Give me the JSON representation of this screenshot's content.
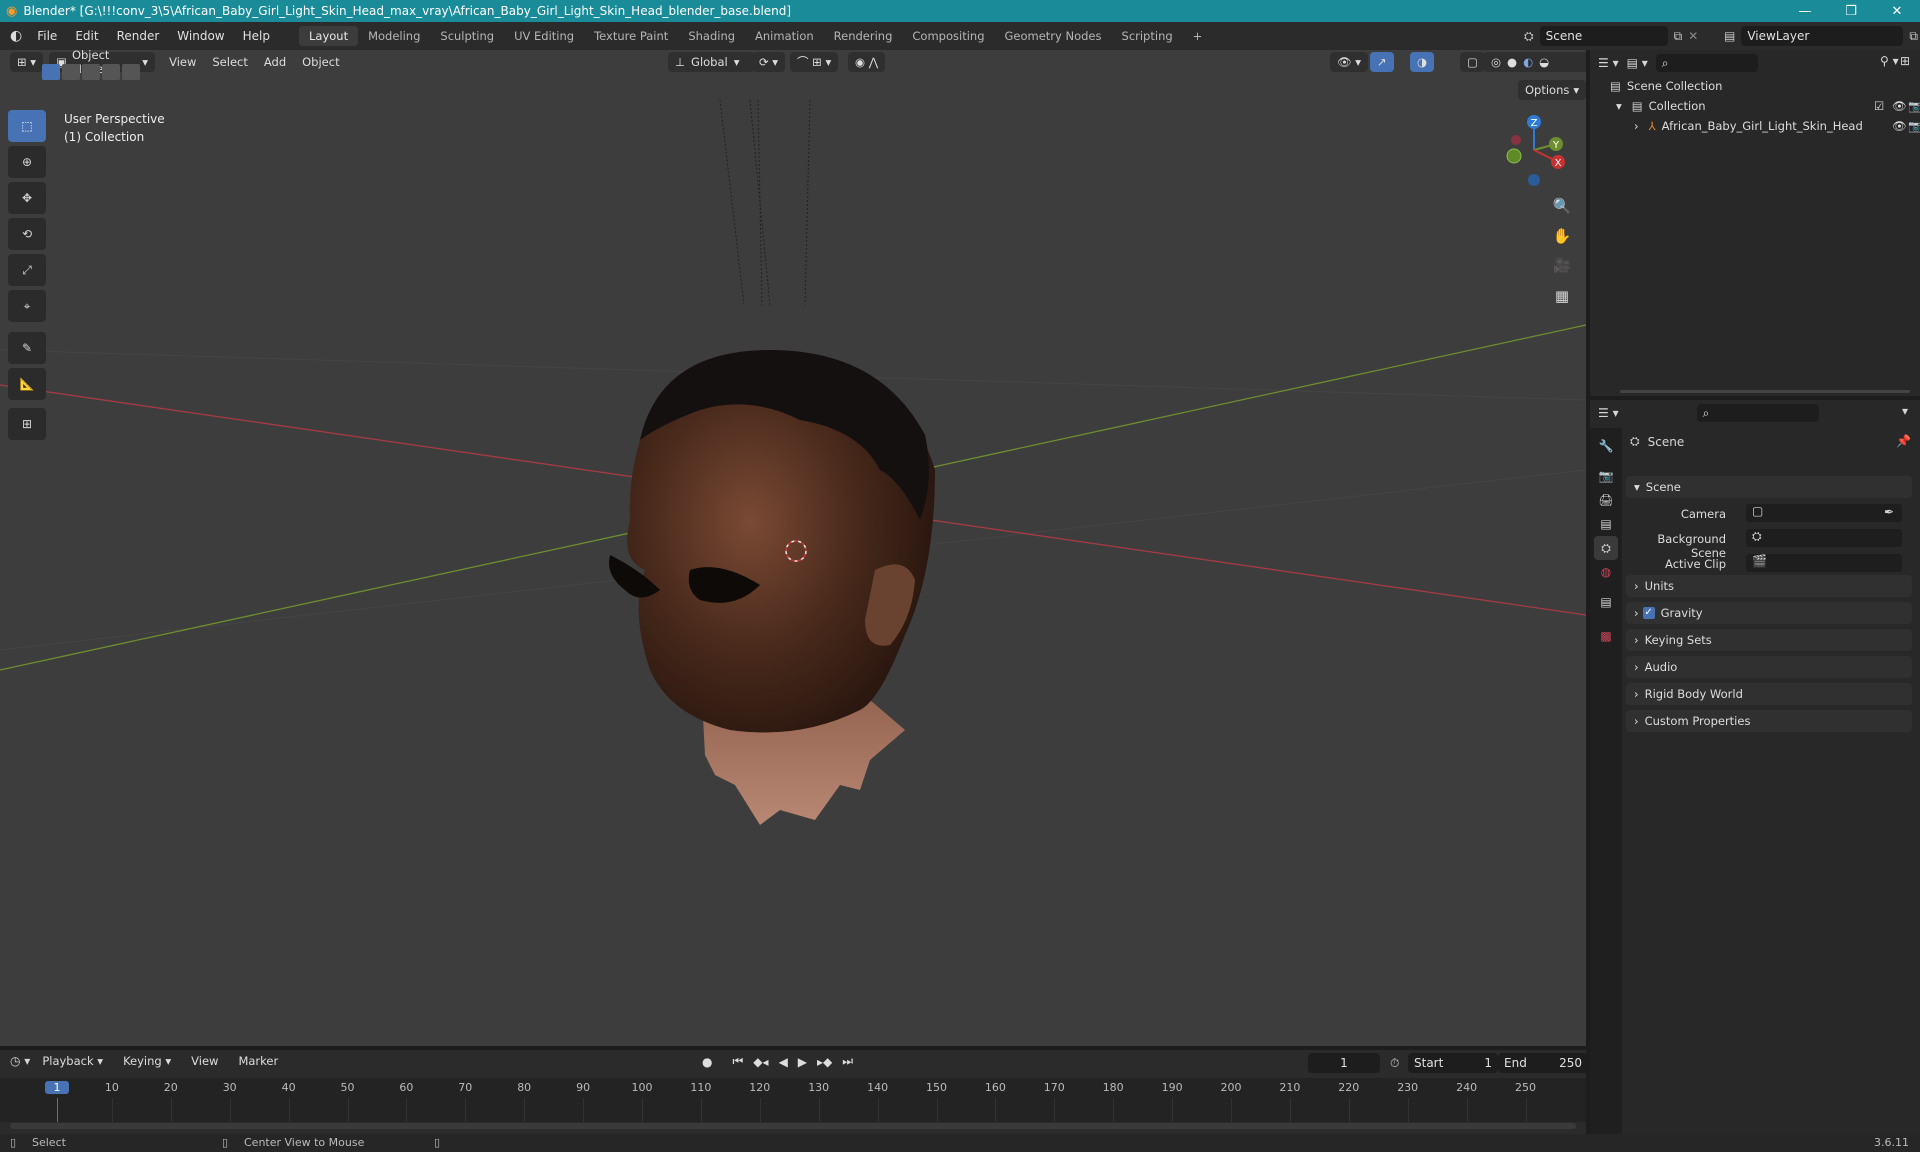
{
  "window": {
    "title": "Blender* [G:\\!!!conv_3\\5\\African_Baby_Girl_Light_Skin_Head_max_vray\\African_Baby_Girl_Light_Skin_Head_blender_base.blend]",
    "minimize": "—",
    "restore": "❐",
    "close": "✕"
  },
  "menus": [
    "File",
    "Edit",
    "Render",
    "Window",
    "Help"
  ],
  "workspaces": [
    "Layout",
    "Modeling",
    "Sculpting",
    "UV Editing",
    "Texture Paint",
    "Shading",
    "Animation",
    "Rendering",
    "Compositing",
    "Geometry Nodes",
    "Scripting"
  ],
  "add_workspace": "+",
  "scene": {
    "name": "Scene",
    "view_layer": "ViewLayer"
  },
  "viewport": {
    "mode": "Object Mode",
    "menus": [
      "View",
      "Select",
      "Add",
      "Object"
    ],
    "orientation": "Global",
    "options": "Options",
    "overlay_title": "User Perspective",
    "overlay_sub": "(1) Collection",
    "gizmo": {
      "z": "Z",
      "y": "Y",
      "x": "X"
    }
  },
  "outliner": {
    "root": "Scene Collection",
    "collection": "Collection",
    "object": "African_Baby_Girl_Light_Skin_Head"
  },
  "properties": {
    "header": "Scene",
    "section": "Scene",
    "camera_label": "Camera",
    "background_label": "Background Scene",
    "clip_label": "Active Clip",
    "panels": [
      "Units",
      "Gravity",
      "Keying Sets",
      "Audio",
      "Rigid Body World",
      "Custom Properties"
    ],
    "gravity_checked": true
  },
  "timeline": {
    "menus": [
      "Playback",
      "Keying",
      "View",
      "Marker"
    ],
    "current_frame": "1",
    "start_label": "Start",
    "start": "1",
    "end_label": "End",
    "end": "250",
    "ticks": [
      "1",
      "10",
      "20",
      "30",
      "40",
      "50",
      "60",
      "70",
      "80",
      "90",
      "100",
      "110",
      "120",
      "130",
      "140",
      "150",
      "160",
      "170",
      "180",
      "190",
      "200",
      "210",
      "220",
      "230",
      "240",
      "250"
    ]
  },
  "status": {
    "select": "Select",
    "center": "Center View to Mouse",
    "version": "3.6.11"
  },
  "colors": {
    "accent": "#4772b3",
    "title_bar": "#1a8c99",
    "x_axis": "#a83a45",
    "y_axis": "#6e8f2f",
    "z_axis": "#2f7bd8"
  }
}
